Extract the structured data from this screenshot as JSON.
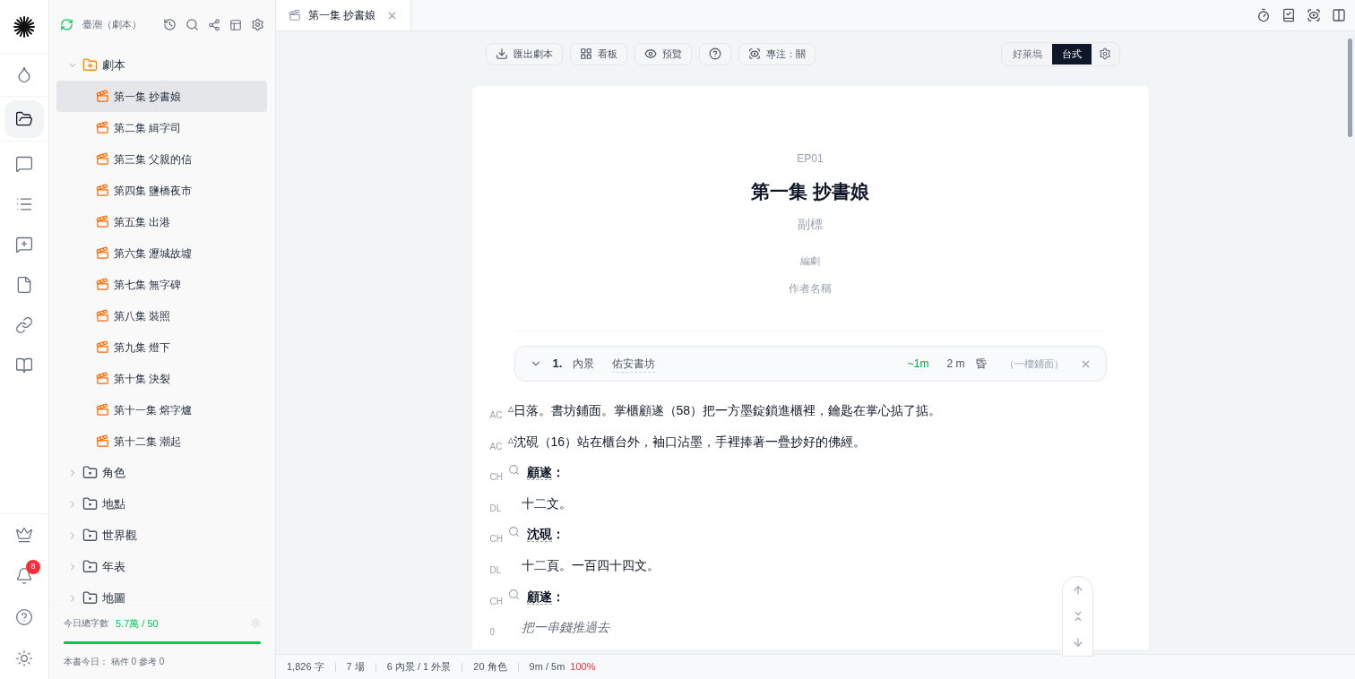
{
  "rail": {
    "items": [
      {
        "kind": "droplet",
        "selected": false
      },
      {
        "kind": "folder",
        "selected": true
      },
      {
        "kind": "chat",
        "selected": false
      },
      {
        "kind": "list",
        "selected": false
      },
      {
        "kind": "note",
        "selected": false
      },
      {
        "kind": "file",
        "selected": false
      },
      {
        "kind": "link",
        "selected": false
      },
      {
        "kind": "book",
        "selected": false
      }
    ],
    "bottom": [
      {
        "kind": "crown"
      },
      {
        "kind": "bell",
        "badge": "8"
      },
      {
        "kind": "help"
      },
      {
        "kind": "theme"
      }
    ]
  },
  "sidebar": {
    "title": "臺潮（劇本）",
    "tree": [
      {
        "label": "劇本",
        "expanded": true,
        "children": [
          {
            "label": "第一集 抄書娘",
            "selected": true
          },
          {
            "label": "第二集 緝字司",
            "selected": false
          },
          {
            "label": "第三集 父親的信",
            "selected": false
          },
          {
            "label": "第四集 鹽橋夜市",
            "selected": false
          },
          {
            "label": "第五集 出港",
            "selected": false
          },
          {
            "label": "第六集 瀝城故墟",
            "selected": false
          },
          {
            "label": "第七集 無字碑",
            "selected": false
          },
          {
            "label": "第八集 裝照",
            "selected": false
          },
          {
            "label": "第九集 燈下",
            "selected": false
          },
          {
            "label": "第十集 決裂",
            "selected": false
          },
          {
            "label": "第十一集 熔字爐",
            "selected": false
          },
          {
            "label": "第十二集 潮起",
            "selected": false
          }
        ]
      },
      {
        "label": "角色",
        "expanded": false
      },
      {
        "label": "地點",
        "expanded": false
      },
      {
        "label": "世界觀",
        "expanded": false
      },
      {
        "label": "年表",
        "expanded": false
      },
      {
        "label": "地圖",
        "expanded": false
      }
    ],
    "footer": {
      "label": "今日總字數",
      "count": "5.7萬 / 50",
      "level": 1,
      "note": "本書今日： 稿件 0  參考 0"
    }
  },
  "tab": {
    "label": "第一集 抄書娘"
  },
  "toolbar": [
    {
      "kind": "export",
      "label": "匯出劇本"
    },
    {
      "kind": "board",
      "label": "看板"
    },
    {
      "kind": "preview",
      "label": "預覽"
    },
    {
      "kind": "help"
    },
    {
      "kind": "focus",
      "label": "專注：關"
    }
  ],
  "formats": [
    {
      "label": "好萊塢",
      "selected": false
    },
    {
      "label": "台式",
      "selected": true
    }
  ],
  "document": {
    "episode": "EP01",
    "title": "第一集 抄書娘",
    "subtitle_placeholder": "副標",
    "writer_label": "編劇",
    "author_placeholder": "作者名稱",
    "scene": {
      "number": "1.",
      "setting": "內景",
      "location": "佑安書坊",
      "estimate": "~1m",
      "duration": "2 m",
      "time": "昏",
      "note": "（一樓鋪面）",
      "expanded": true
    },
    "lines": [
      {
        "kind": "action",
        "gutter": "AC",
        "marker": "△",
        "text": "日落。書坊鋪面。掌櫃顧遂（58）把一方墨錠鎖進櫃裡，鑰匙在掌心掂了掂。"
      },
      {
        "kind": "action",
        "gutter": "AC",
        "marker": "△",
        "text": "沈硯（16）站在櫃台外，袖口沾墨，手裡捧著一疊抄好的佛經。"
      },
      {
        "kind": "character",
        "gutter": "CH",
        "name": "顧遂",
        "colon": "："
      },
      {
        "kind": "dialogue",
        "gutter": "DL",
        "text": "十二文。"
      },
      {
        "kind": "character",
        "gutter": "CH",
        "name": "沈硯",
        "colon": "："
      },
      {
        "kind": "dialogue",
        "gutter": "DL",
        "text": "十二頁。一百四十四文。"
      },
      {
        "kind": "character",
        "gutter": "CH",
        "name": "顧遂",
        "colon": "："
      },
      {
        "kind": "parenthetical",
        "gutter": "0",
        "text": "把一串錢推過去"
      }
    ]
  },
  "status_bar": {
    "words": "1,826 字",
    "scenes": "7 場",
    "settings": "6 內景 / 1 外景",
    "characters": "20 角色",
    "time": "9m / 5m",
    "percent": "100%"
  }
}
